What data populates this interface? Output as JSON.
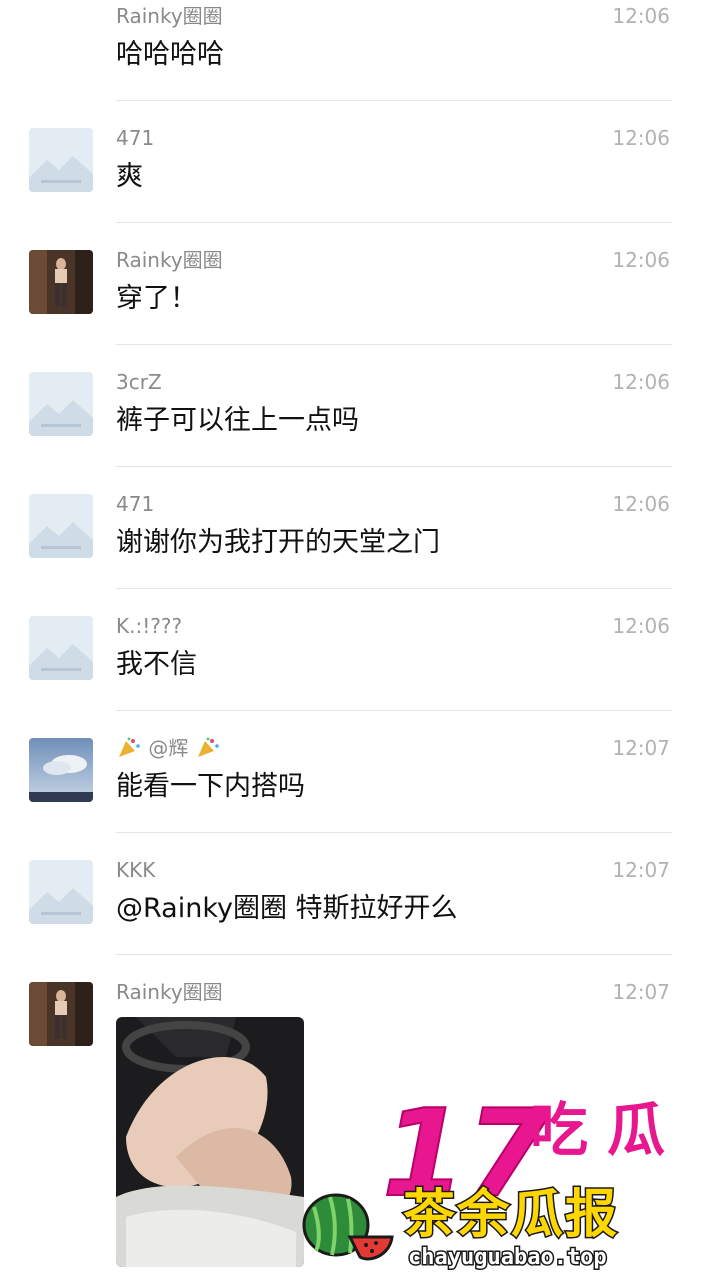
{
  "messages": [
    {
      "sender": "Rainky圈圈",
      "time": "12:06",
      "text": "哈哈哈哈",
      "avatar": "none"
    },
    {
      "sender": "471",
      "time": "12:06",
      "text": "爽",
      "avatar": "placeholder-icon"
    },
    {
      "sender": "Rainky圈圈",
      "time": "12:06",
      "text": "穿了！",
      "avatar": "photo-avatar"
    },
    {
      "sender": "3crZ",
      "time": "12:06",
      "text": "裤子可以往上一点吗",
      "avatar": "placeholder-icon"
    },
    {
      "sender": "471",
      "time": "12:06",
      "text": "谢谢你为我打开的天堂之门",
      "avatar": "placeholder-icon"
    },
    {
      "sender": "K.:!???",
      "time": "12:06",
      "text": "我不信",
      "avatar": "placeholder-icon"
    },
    {
      "sender": "@辉",
      "time": "12:07",
      "text": "能看一下内搭吗",
      "avatar": "sky-avatar"
    },
    {
      "sender": "KKK",
      "time": "12:07",
      "text": "@Rainky圈圈 特斯拉好开么",
      "avatar": "placeholder-icon"
    },
    {
      "sender": "Rainky圈圈",
      "time": "12:07",
      "text": "",
      "avatar": "photo-avatar"
    }
  ],
  "watermark": {
    "logo_17": "17",
    "logo_chi": "吃",
    "logo_gua": "瓜",
    "brand": "茶余瓜报",
    "url": "chayuguabao.top"
  },
  "colors": {
    "name": "#8a8a8a",
    "time": "#b2b2b2",
    "text": "#111111",
    "divider": "#e5e5e5",
    "watermark_pink": "#e8168f",
    "watermark_yellow": "#ffd700"
  }
}
